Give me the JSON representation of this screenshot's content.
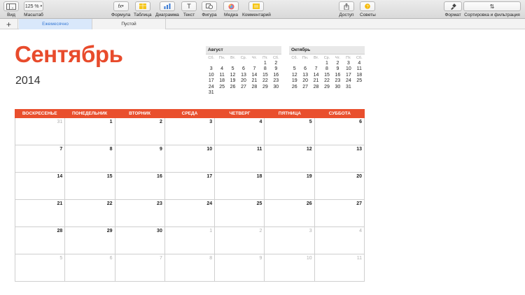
{
  "toolbar": {
    "view": "Вид",
    "zoom_value": "125 %",
    "zoom": "Масштаб",
    "formula": "Формула",
    "table": "Таблица",
    "chart": "Диаграмма",
    "text": "Текст",
    "shape": "Фигура",
    "media": "Медиа",
    "comment": "Комментарий",
    "share": "Доступ",
    "tips": "Советы",
    "format": "Формат",
    "sort": "Сортировка и фильтрация"
  },
  "tabs": {
    "monthly": "Ежемесячно",
    "empty": "Пустой"
  },
  "calendar": {
    "month": "Сентябрь",
    "year": "2014",
    "weekdays": [
      "ВОСКРЕСЕНЬЕ",
      "ПОНЕДЕЛЬНИК",
      "ВТОРНИК",
      "СРЕДА",
      "ЧЕТВЕРГ",
      "ПЯТНИЦА",
      "СУББОТА"
    ],
    "weeks": [
      [
        "31",
        "1",
        "2",
        "3",
        "4",
        "5",
        "6"
      ],
      [
        "7",
        "8",
        "9",
        "10",
        "11",
        "12",
        "13"
      ],
      [
        "14",
        "15",
        "16",
        "17",
        "18",
        "19",
        "20"
      ],
      [
        "21",
        "22",
        "23",
        "24",
        "25",
        "26",
        "27"
      ],
      [
        "28",
        "29",
        "30",
        "1",
        "2",
        "3",
        "4"
      ],
      [
        "5",
        "6",
        "7",
        "8",
        "9",
        "10",
        "11"
      ]
    ],
    "other_month": [
      [
        true,
        false,
        false,
        false,
        false,
        false,
        false
      ],
      [
        false,
        false,
        false,
        false,
        false,
        false,
        false
      ],
      [
        false,
        false,
        false,
        false,
        false,
        false,
        false
      ],
      [
        false,
        false,
        false,
        false,
        false,
        false,
        false
      ],
      [
        false,
        false,
        false,
        true,
        true,
        true,
        true
      ],
      [
        true,
        true,
        true,
        true,
        true,
        true,
        true
      ]
    ]
  },
  "mini_august": {
    "title": "Август",
    "dow": [
      "Сб.",
      "Пн.",
      "Вт.",
      "Ср.",
      "Чт.",
      "Пт.",
      "Сб."
    ],
    "weeks": [
      [
        "",
        "",
        "",
        "",
        "",
        "1",
        "2"
      ],
      [
        "3",
        "4",
        "5",
        "6",
        "7",
        "8",
        "9"
      ],
      [
        "10",
        "11",
        "12",
        "13",
        "14",
        "15",
        "16"
      ],
      [
        "17",
        "18",
        "19",
        "20",
        "21",
        "22",
        "23"
      ],
      [
        "24",
        "25",
        "26",
        "27",
        "28",
        "29",
        "30"
      ],
      [
        "31",
        "",
        "",
        "",
        "",
        "",
        ""
      ]
    ]
  },
  "mini_october": {
    "title": "Октябрь",
    "dow": [
      "Сб.",
      "Пн.",
      "Вт.",
      "Ср.",
      "Чт.",
      "Пт.",
      "Сб."
    ],
    "weeks": [
      [
        "",
        "",
        "",
        "1",
        "2",
        "3",
        "4"
      ],
      [
        "5",
        "6",
        "7",
        "8",
        "9",
        "10",
        "11"
      ],
      [
        "12",
        "13",
        "14",
        "15",
        "16",
        "17",
        "18"
      ],
      [
        "19",
        "20",
        "21",
        "22",
        "23",
        "24",
        "25"
      ],
      [
        "26",
        "27",
        "28",
        "29",
        "30",
        "31",
        ""
      ]
    ]
  },
  "colors": {
    "accent": "#e94f2d",
    "tab_active_bg": "#d9e8fb",
    "tab_active_text": "#3a7bd5"
  },
  "icons": {
    "view": "sidebar-icon",
    "formula": "fx-icon",
    "table": "table-icon",
    "chart": "chart-icon",
    "text": "text-icon",
    "shape": "shape-icon",
    "media": "media-icon",
    "comment": "comment-icon",
    "share": "share-icon",
    "tips": "tips-icon",
    "format": "format-brush-icon",
    "sort": "sort-icon",
    "add": "plus-icon"
  }
}
